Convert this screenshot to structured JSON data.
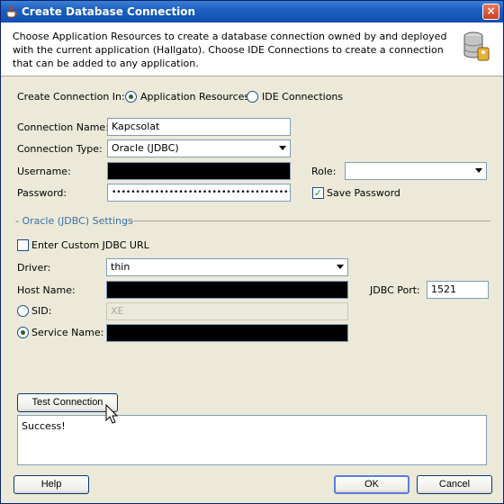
{
  "window": {
    "title": "Create Database Connection",
    "close": "×"
  },
  "header": {
    "description": "Choose Application Resources to create a database connection owned by and deployed with the current application (Hallgato). Choose IDE Connections to create a connection that can be added to any application."
  },
  "create_in": {
    "label": "Create Connection In:",
    "options": [
      {
        "label": "Application Resources",
        "selected": true
      },
      {
        "label": "IDE Connections",
        "selected": false
      }
    ]
  },
  "connection": {
    "name_label": "Connection Name:",
    "name_value": "Kapcsolat",
    "type_label": "Connection Type:",
    "type_value": "Oracle (JDBC)",
    "username_label": "Username:",
    "password_label": "Password:",
    "password_value": "••••••••••••••••••••••••••••••••••••••",
    "role_label": "Role:",
    "role_value": "",
    "save_password_label": "Save Password",
    "save_password_checked": true
  },
  "settings": {
    "section_title": "- Oracle (JDBC) Settings",
    "custom_url_label": "Enter Custom JDBC URL",
    "custom_url_checked": false,
    "driver_label": "Driver:",
    "driver_value": "thin",
    "host_label": "Host Name:",
    "port_label": "JDBC Port:",
    "port_value": "1521",
    "sid_label": "SID:",
    "sid_value": "XE",
    "service_label": "Service Name:"
  },
  "test": {
    "button_label": "Test Connection",
    "result": "Success!"
  },
  "footer": {
    "help_label": "Help",
    "ok_label": "OK",
    "cancel_label": "Cancel"
  }
}
